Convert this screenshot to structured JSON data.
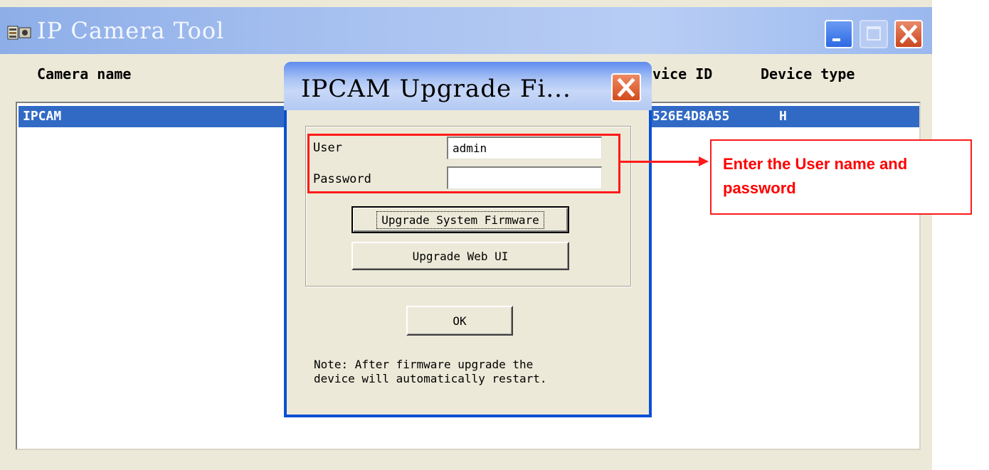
{
  "window": {
    "title": "IP Camera Tool"
  },
  "list": {
    "columns": {
      "camera_name": "Camera name",
      "device_id": "vice ID",
      "device_type": "Device type"
    },
    "rows": [
      {
        "camera_name": "IPCAM",
        "device_id": "526E4D8A55",
        "device_type": "H"
      }
    ]
  },
  "dialog": {
    "title": "IPCAM Upgrade Fi...",
    "user_label": "User",
    "user_value": "admin",
    "password_label": "Password",
    "password_value": "",
    "upgrade_firmware_label": "Upgrade System Firmware",
    "upgrade_webui_label": "Upgrade Web UI",
    "ok_label": "OK",
    "note": "Note: After firmware upgrade the\ndevice will automatically restart."
  },
  "annotation": {
    "callout_text": "Enter the User name and password",
    "color": "#ff0000"
  },
  "colors": {
    "selection": "#316ac5",
    "window_bg": "#ece9d8",
    "dialog_frame": "#0a4fd6"
  },
  "icons": {
    "app": "camera-tool-icon",
    "minimize": "minimize-icon",
    "maximize": "maximize-icon",
    "close": "close-icon"
  }
}
